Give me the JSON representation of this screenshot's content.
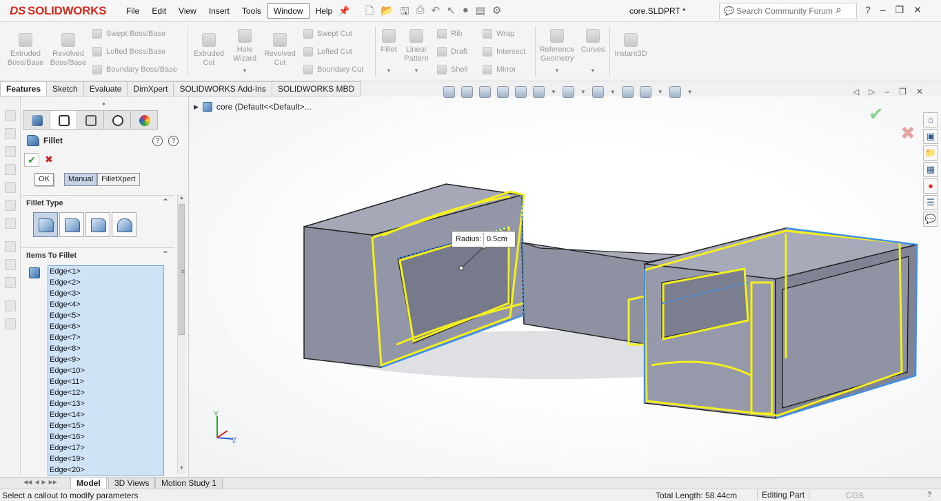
{
  "app": {
    "logo": "SOLIDWORKS",
    "logo_mark": "DS",
    "document_title": "core.SLDPRT *"
  },
  "menu": [
    "File",
    "Edit",
    "View",
    "Insert",
    "Tools",
    "Window",
    "Help"
  ],
  "search": {
    "placeholder": "Search Community Forum"
  },
  "commands": {
    "extruded_boss": "Extruded Boss/Base",
    "revolved_boss": "Revolved Boss/Base",
    "swept_boss": "Swept Boss/Base",
    "lofted_boss": "Lofted Boss/Base",
    "boundary_boss": "Boundary Boss/Base",
    "extruded_cut": "Extruded Cut",
    "hole_wizard": "Hole Wizard",
    "revolved_cut": "Revolved Cut",
    "swept_cut": "Swept Cut",
    "lofted_cut": "Lofted Cut",
    "boundary_cut": "Boundary Cut",
    "fillet": "Fillet",
    "linear_pattern": "Linear Pattern",
    "rib": "Rib",
    "draft": "Draft",
    "shell": "Shell",
    "wrap": "Wrap",
    "intersect": "Intersect",
    "mirror": "Mirror",
    "reference_geometry": "Reference Geometry",
    "curves": "Curves",
    "instant3d": "Instant3D"
  },
  "command_tabs": [
    "Features",
    "Sketch",
    "Evaluate",
    "DimXpert",
    "SOLIDWORKS Add-Ins",
    "SOLIDWORKS MBD"
  ],
  "property_manager": {
    "title": "Fillet",
    "ok_label": "OK",
    "mode_manual": "Manual",
    "mode_filletxpert": "FilletXpert",
    "section_fillet_type": "Fillet Type",
    "section_items": "Items To Fillet",
    "edges": [
      "Edge<1>",
      "Edge<2>",
      "Edge<3>",
      "Edge<4>",
      "Edge<5>",
      "Edge<6>",
      "Edge<7>",
      "Edge<8>",
      "Edge<9>",
      "Edge<10>",
      "Edge<11>",
      "Edge<12>",
      "Edge<13>",
      "Edge<14>",
      "Edge<15>",
      "Edge<16>",
      "Edge<17>",
      "Edge<19>",
      "Edge<20>"
    ]
  },
  "tree": {
    "root": "core  (Default<<Default>..."
  },
  "callout": {
    "label": "Radius:",
    "value": "0.5cm"
  },
  "triad": {
    "y": "Y",
    "z": "Z"
  },
  "bottom_tabs": [
    "Model",
    "3D Views",
    "Motion Study 1"
  ],
  "status": {
    "message": "Select a callout to modify parameters",
    "total_length": "Total Length: 58.44cm",
    "mode": "Editing Part",
    "units": "CGS",
    "help": "?"
  },
  "colors": {
    "brand_red": "#d52b1e",
    "selection_yellow": "#f4ef1f",
    "selection_blue": "#3d8fe8",
    "model_face": "#8a8e9e",
    "model_top": "#a4a7b5"
  }
}
